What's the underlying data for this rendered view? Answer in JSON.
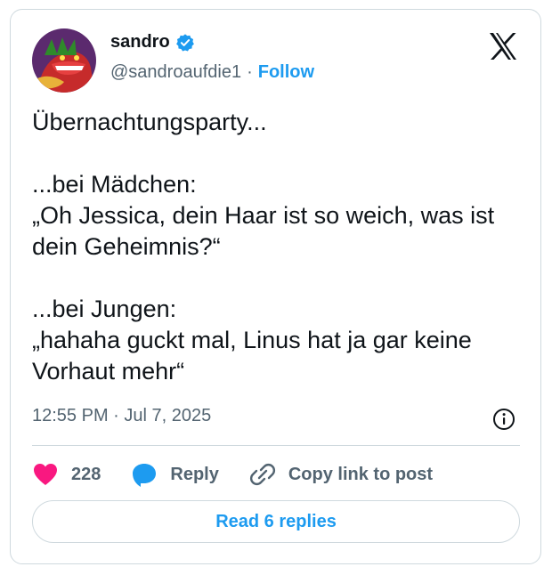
{
  "author": {
    "name": "sandro",
    "handle": "@sandroaufdie1",
    "follow_label": "Follow",
    "separator": "·"
  },
  "icons": {
    "verified": "verified-badge-icon",
    "logo": "x-logo-icon",
    "info": "info-icon",
    "like": "heart-icon",
    "reply": "speech-bubble-icon",
    "copy_link": "link-icon"
  },
  "colors": {
    "accent": "#1d9bf0",
    "like": "#f91880",
    "text": "#0f1419",
    "secondary": "#536471",
    "border": "#cfd9de"
  },
  "tweet": {
    "text": "Übernachtungsparty...\n\n...bei Mädchen:\n„Oh Jessica, dein Haar ist so weich, was ist dein Geheimnis?“\n\n...bei Jungen:\n„hahaha guckt mal, Linus hat ja gar keine Vorhaut mehr“",
    "time": "12:55 PM · Jul 7, 2025"
  },
  "actions": {
    "likes_count": "228",
    "reply_label": "Reply",
    "copy_link_label": "Copy link to post"
  },
  "replies_button": "Read 6 replies"
}
